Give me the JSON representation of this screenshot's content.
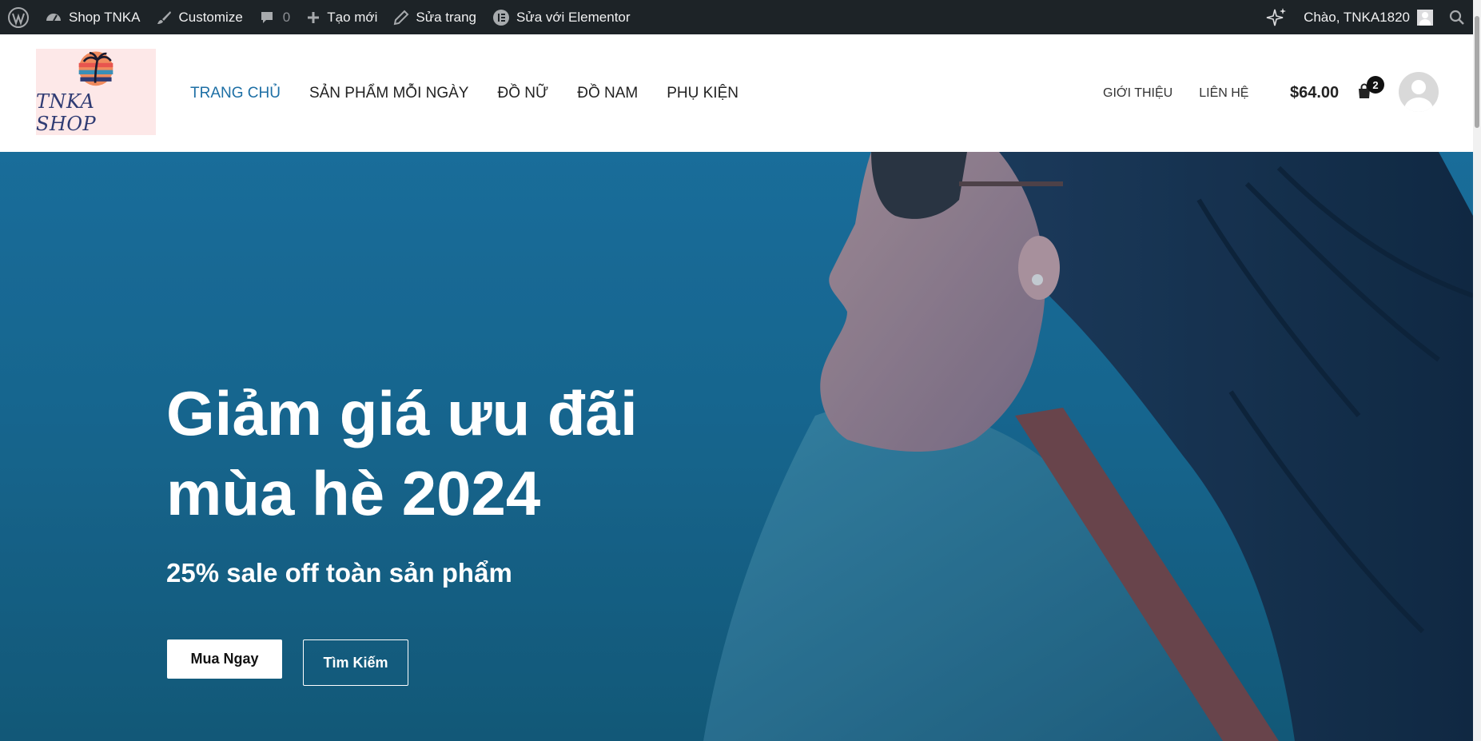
{
  "adminbar": {
    "site_name": "Shop TNKA",
    "customize": "Customize",
    "comments_count": "0",
    "new": "Tạo mới",
    "edit_page": "Sửa trang",
    "elementor": "Sửa với Elementor",
    "greeting": "Chào, TNKA1820"
  },
  "header": {
    "logo_text": "TNKA SHOP",
    "nav": [
      "TRANG CHỦ",
      "SẢN PHẨM MỖI NGÀY",
      "ĐỒ NỮ",
      "ĐỒ NAM",
      "PHỤ KIỆN"
    ],
    "secondary_nav": [
      "GIỚI THIỆU",
      "LIÊN HỆ"
    ],
    "cart_total": "$64.00",
    "cart_count": "2"
  },
  "hero": {
    "title_line1": "Giảm giá ưu đãi",
    "title_line2": "mùa hè 2024",
    "subtitle": "25% sale off toàn sản phẩm",
    "btn_primary": "Mua Ngay",
    "btn_secondary": "Tìm Kiếm"
  },
  "colors": {
    "admin_bar": "#1d2327",
    "nav_active": "#1d6fa5",
    "hero_bg": "#1a6f9e"
  }
}
